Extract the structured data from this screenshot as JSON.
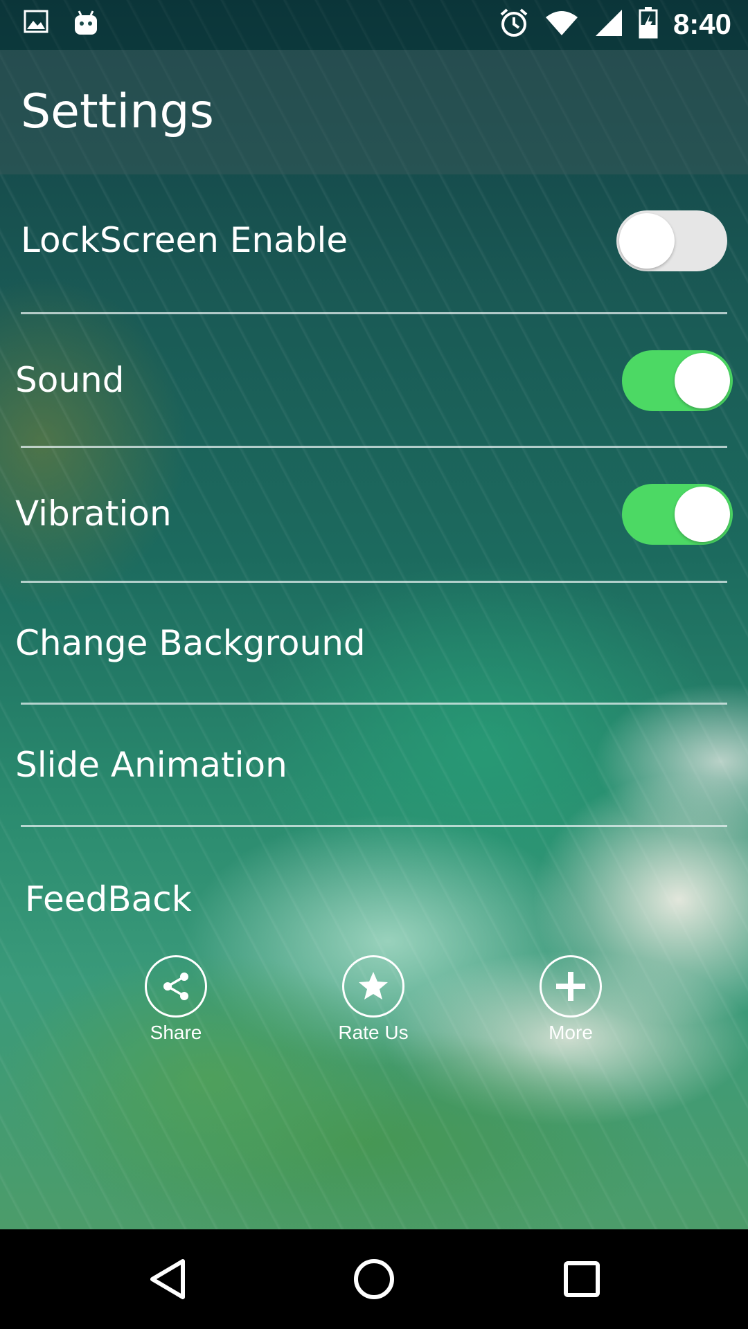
{
  "status_bar": {
    "time": "8:40",
    "left_icons": [
      "image-icon",
      "android-icon"
    ],
    "right_icons": [
      "alarm-icon",
      "wifi-icon",
      "signal-icon",
      "battery-icon"
    ]
  },
  "toolbar": {
    "title": "Settings"
  },
  "settings": {
    "lockscreen": {
      "label": "LockScreen Enable",
      "enabled": false
    },
    "sound": {
      "label": "Sound",
      "enabled": true
    },
    "vibration": {
      "label": "Vibration",
      "enabled": true
    },
    "change_background": {
      "label": "Change Background"
    },
    "slide_animation": {
      "label": "Slide Animation"
    },
    "feedback": {
      "label": "FeedBack"
    }
  },
  "actions": {
    "share": {
      "label": "Share",
      "icon": "share-icon"
    },
    "rate": {
      "label": "Rate Us",
      "icon": "star-icon"
    },
    "more": {
      "label": "More",
      "icon": "plus-icon"
    }
  },
  "nav": {
    "icons": [
      "back-icon",
      "home-icon",
      "recents-icon"
    ]
  },
  "colors": {
    "toggle_on": "#4cd964",
    "toggle_off": "#e6e6e6",
    "nav_bg": "#000000"
  }
}
